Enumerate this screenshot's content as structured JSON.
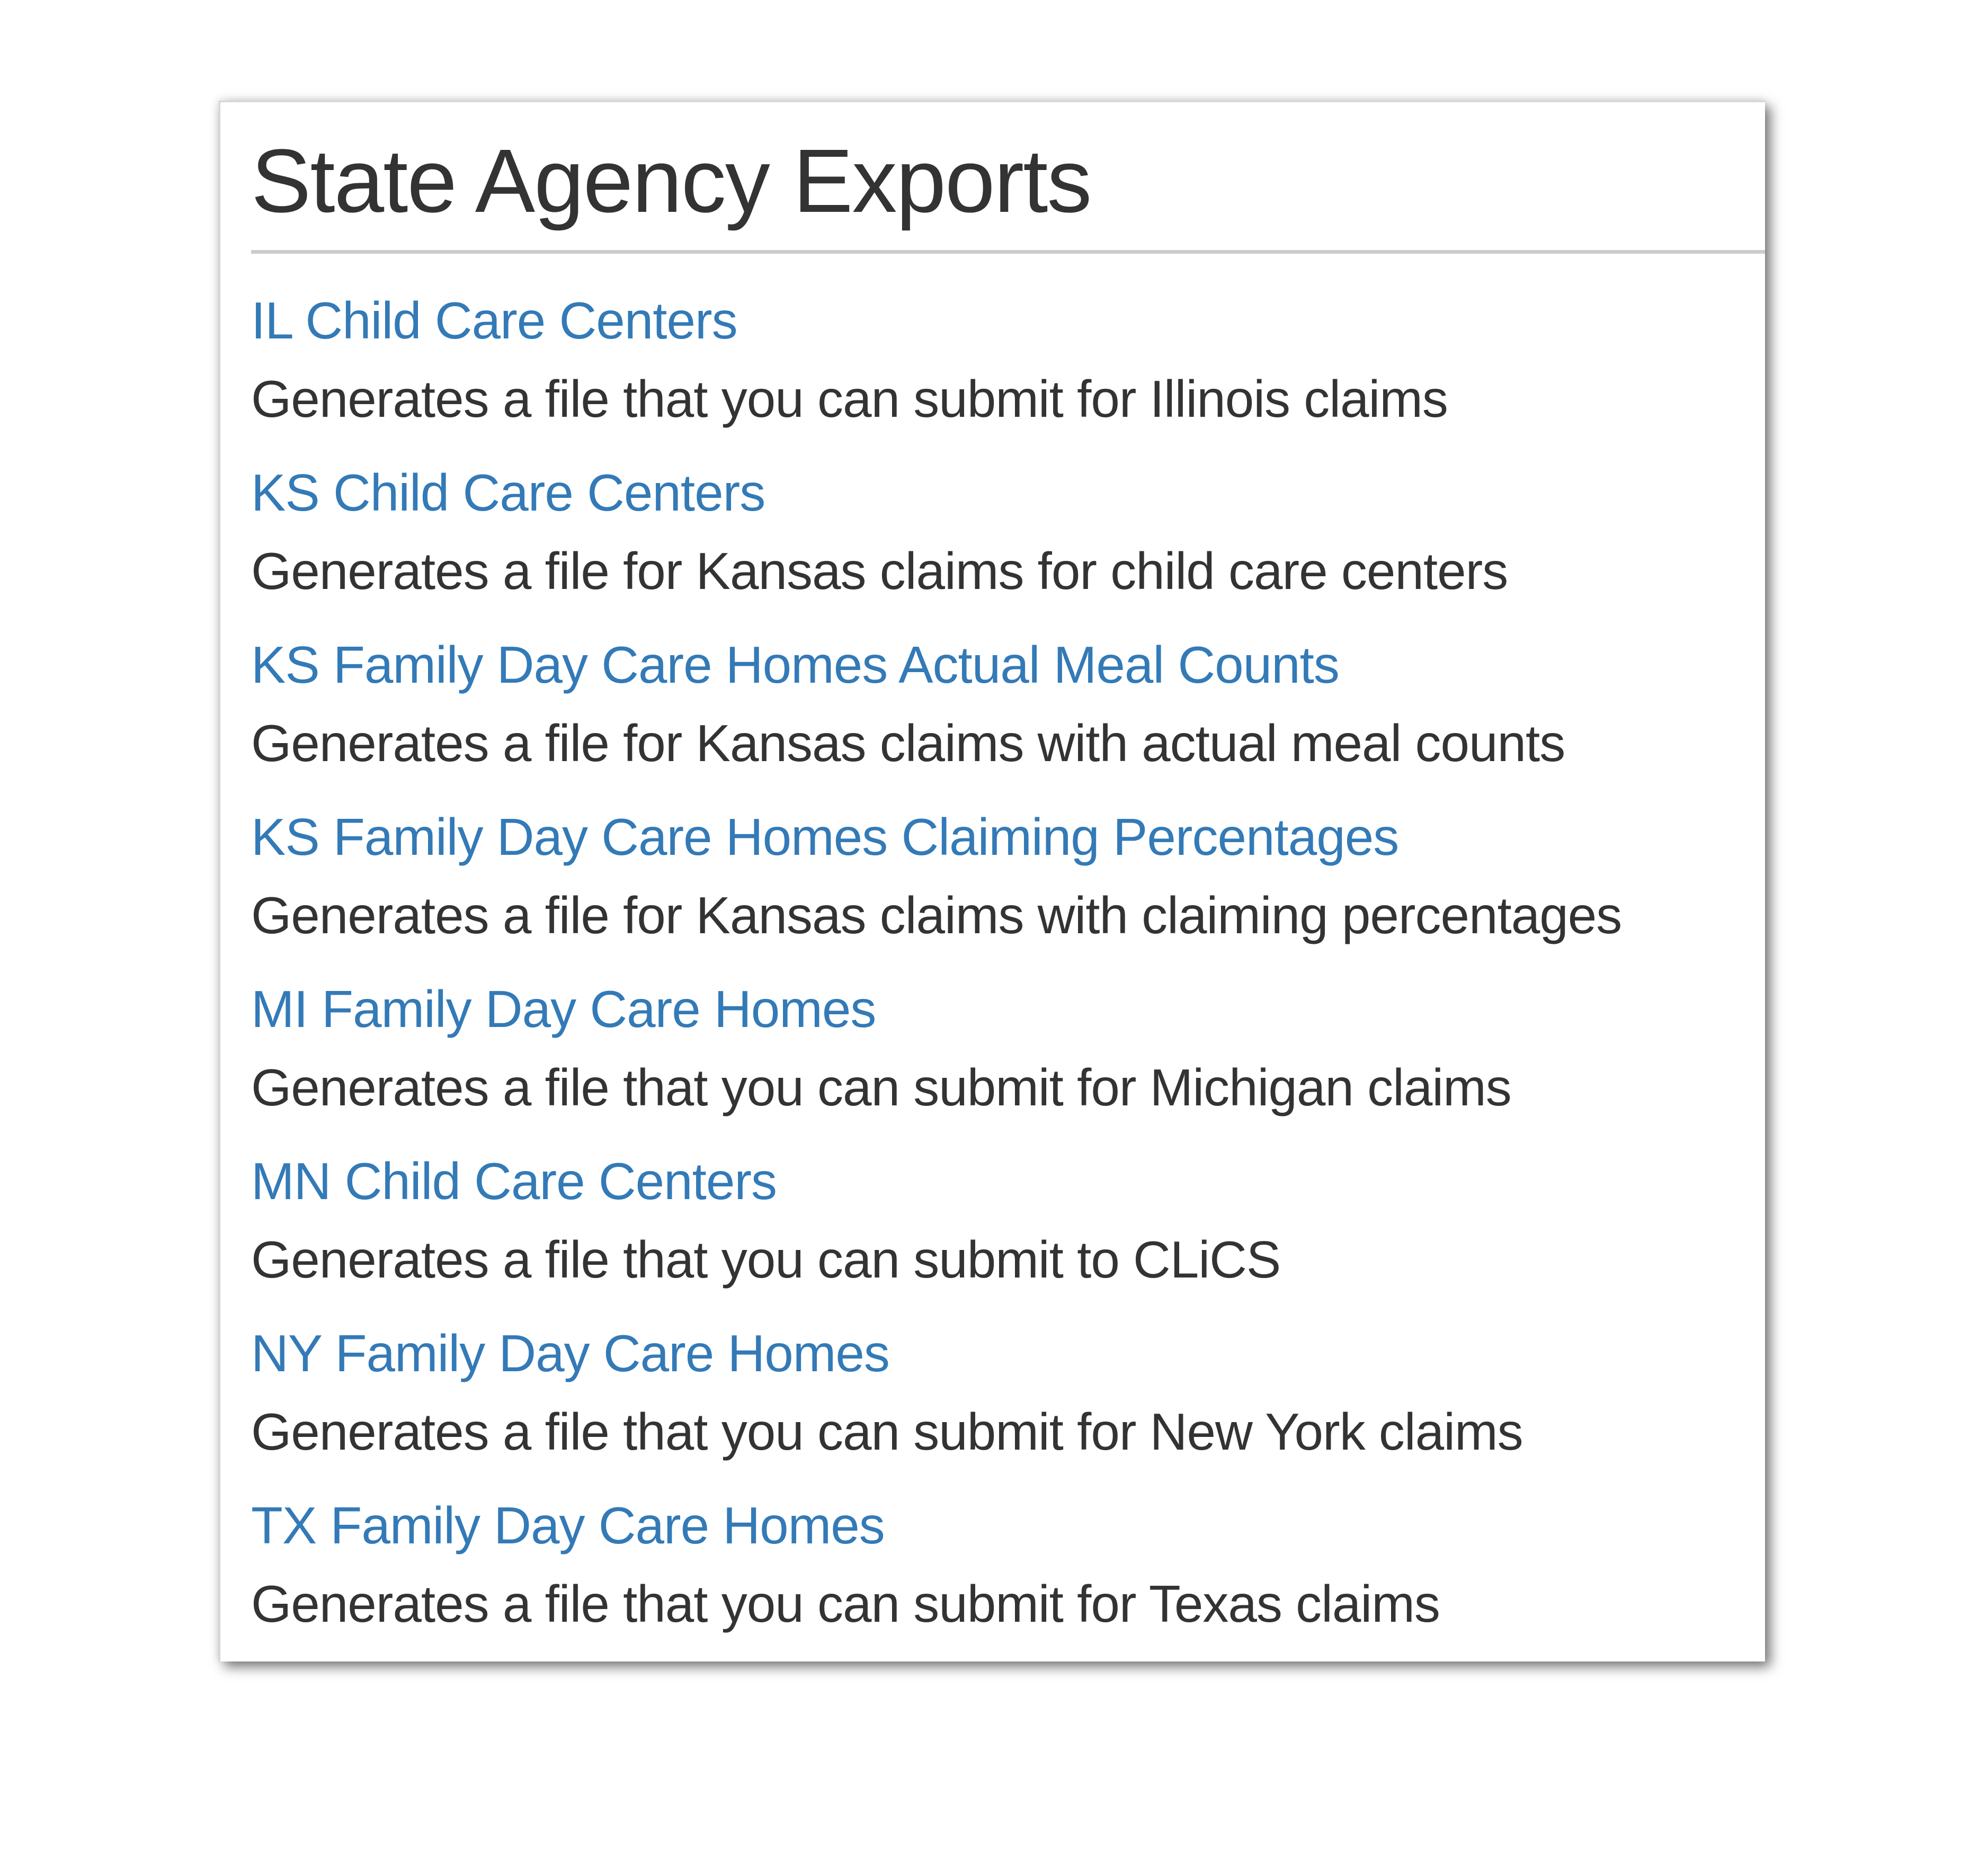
{
  "page": {
    "title": "State Agency Exports"
  },
  "colors": {
    "link": "#337ab7",
    "text": "#333333",
    "separator": "#cccccc"
  },
  "exports": [
    {
      "label": "IL Child Care Centers",
      "description": "Generates a file that you can submit for Illinois claims"
    },
    {
      "label": "KS Child Care Centers",
      "description": "Generates a file for Kansas claims for child care centers"
    },
    {
      "label": "KS Family Day Care Homes Actual Meal Counts",
      "description": "Generates a file for Kansas claims with actual meal counts"
    },
    {
      "label": "KS Family Day Care Homes Claiming Percentages",
      "description": "Generates a file for Kansas claims with claiming percentages"
    },
    {
      "label": "MI Family Day Care Homes",
      "description": "Generates a file that you can submit for Michigan claims"
    },
    {
      "label": "MN Child Care Centers",
      "description": "Generates a file that you can submit to CLiCS"
    },
    {
      "label": "NY Family Day Care Homes",
      "description": "Generates a file that you can submit for New York claims"
    },
    {
      "label": "TX Family Day Care Homes",
      "description": "Generates a file that you can submit for Texas claims"
    }
  ]
}
